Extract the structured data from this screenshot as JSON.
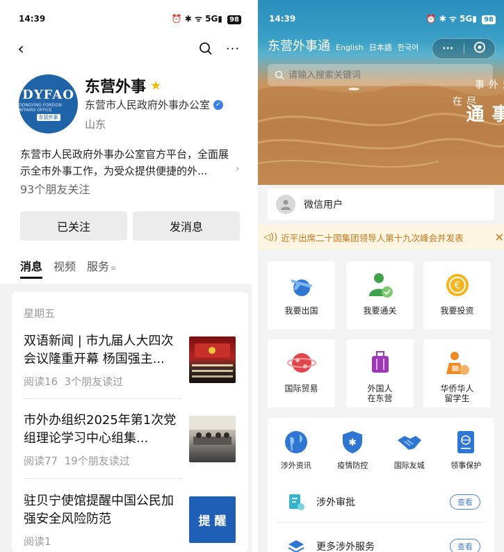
{
  "left": {
    "status": {
      "time": "14:39",
      "battery": "98",
      "signal": "5G"
    },
    "profile": {
      "name": "东营外事",
      "org": "东营市人民政府外事办公室",
      "region": "山东",
      "logo_text": "DYFAO",
      "logo_sub": "DONGYING FOREIGN AFFAIRS OFFICE",
      "logo_tag": "东营外事",
      "description": "东营市人民政府外事办公室官方平台，全面展示全市外事工作，为受众提供便捷的外...",
      "friends_follow": "93个朋友关注"
    },
    "buttons": {
      "followed": "已关注",
      "message": "发消息"
    },
    "tabs": [
      {
        "label": "消息",
        "active": true
      },
      {
        "label": "视频"
      },
      {
        "label": "服务"
      }
    ],
    "feed": {
      "day": "星期五",
      "articles": [
        {
          "title": "双语新闻 | 市九届人大四次会议隆重开幕 杨国强主...",
          "read": "阅读16",
          "friends": "3个朋友读过"
        },
        {
          "title": "市外办组织2025年第1次党组理论学习中心组集...",
          "read": "阅读77",
          "friends": "19个朋友读过"
        },
        {
          "title": "驻贝宁使馆提醒中国公民加强安全风险防范",
          "read": "阅读1",
          "friends": "",
          "thumb_text": "提 醒"
        }
      ]
    }
  },
  "right": {
    "status": {
      "time": "14:39",
      "battery": "98",
      "signal": "5G"
    },
    "header": {
      "title": "东营外事通",
      "langs": [
        "English",
        "日本語",
        "한국어"
      ]
    },
    "search": {
      "placeholder": "请输入搜索关键词"
    },
    "banner_calligraphy": {
      "col1": "点滴涉外事",
      "col2": "尽在",
      "big": "外事通"
    },
    "user": {
      "name": "微信用户"
    },
    "notice": {
      "text": "近平出席二十国集团领导人第十九次峰会并发表"
    },
    "grid": [
      {
        "label": "我要出国"
      },
      {
        "label": "我要通关"
      },
      {
        "label": "我要投资"
      },
      {
        "label": "国际贸易"
      },
      {
        "label": "外国人\n在东营"
      },
      {
        "label": "华侨华人\n留学生"
      }
    ],
    "services": [
      {
        "label": "涉外资讯"
      },
      {
        "label": "疫情防控"
      },
      {
        "label": "国际友城"
      },
      {
        "label": "领事保护"
      }
    ],
    "list": [
      {
        "label": "涉外审批",
        "action": "查看"
      },
      {
        "label": "更多涉外服务",
        "action": "查看"
      }
    ],
    "colors": {
      "accent": "#4b7fd6",
      "notice_bg": "#fdf4e1",
      "notice_text": "#c8781c"
    }
  }
}
